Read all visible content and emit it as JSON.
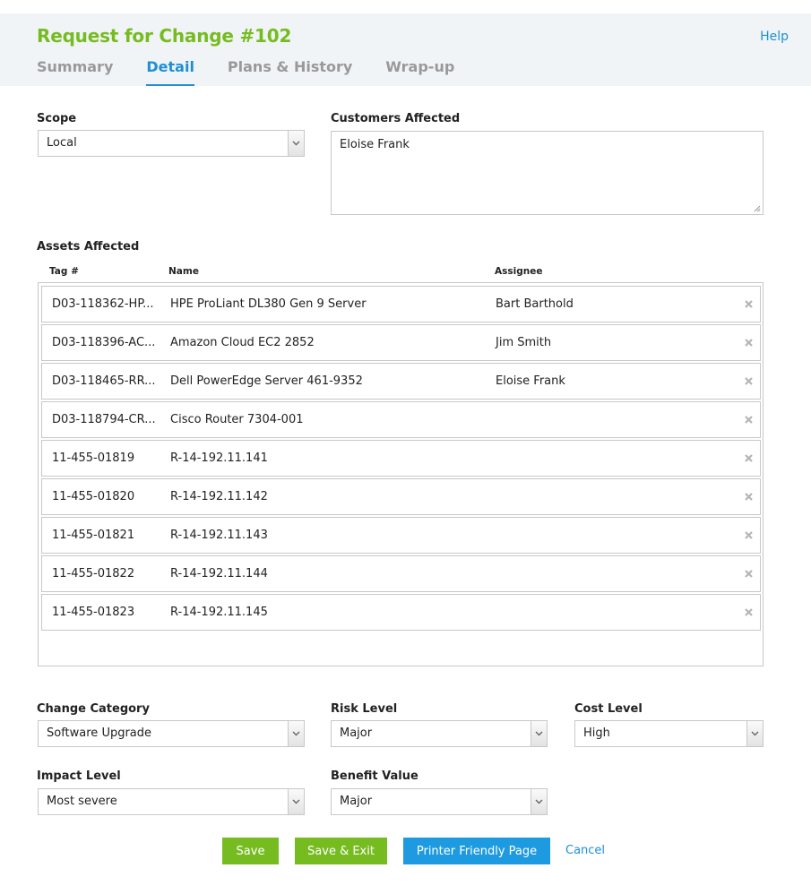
{
  "header": {
    "title": "Request for Change #102",
    "help": "Help",
    "tabs": [
      "Summary",
      "Detail",
      "Plans & History",
      "Wrap-up"
    ],
    "active_tab": "Detail"
  },
  "scope": {
    "label": "Scope",
    "value": "Local"
  },
  "customers": {
    "label": "Customers Affected",
    "value": "Eloise Frank"
  },
  "assets": {
    "label": "Assets Affected",
    "columns": [
      "Tag #",
      "Name",
      "Assignee"
    ],
    "rows": [
      {
        "tag": "D03-118362-HP...",
        "name": "HPE ProLiant DL380 Gen 9 Server",
        "assignee": "Bart Barthold"
      },
      {
        "tag": "D03-118396-AC...",
        "name": "Amazon Cloud EC2 2852",
        "assignee": "Jim Smith"
      },
      {
        "tag": "D03-118465-RR...",
        "name": "Dell PowerEdge Server 461-9352",
        "assignee": "Eloise Frank"
      },
      {
        "tag": "D03-118794-CR...",
        "name": "Cisco Router 7304-001",
        "assignee": ""
      },
      {
        "tag": "11-455-01819",
        "name": "R-14-192.11.141",
        "assignee": ""
      },
      {
        "tag": "11-455-01820",
        "name": "R-14-192.11.142",
        "assignee": ""
      },
      {
        "tag": "11-455-01821",
        "name": "R-14-192.11.143",
        "assignee": ""
      },
      {
        "tag": "11-455-01822",
        "name": "R-14-192.11.144",
        "assignee": ""
      },
      {
        "tag": "11-455-01823",
        "name": "R-14-192.11.145",
        "assignee": ""
      }
    ]
  },
  "change_category": {
    "label": "Change Category",
    "value": "Software Upgrade"
  },
  "risk_level": {
    "label": "Risk Level",
    "value": "Major"
  },
  "cost_level": {
    "label": "Cost Level",
    "value": "High"
  },
  "impact_level": {
    "label": "Impact Level",
    "value": "Most severe"
  },
  "benefit_value": {
    "label": "Benefit Value",
    "value": "Major"
  },
  "actions": {
    "save": "Save",
    "save_exit": "Save & Exit",
    "printer": "Printer Friendly Page",
    "cancel": "Cancel"
  },
  "colors": {
    "brand_green": "#76bc21",
    "link_blue": "#1e8fd6",
    "button_blue": "#1e9be0"
  }
}
